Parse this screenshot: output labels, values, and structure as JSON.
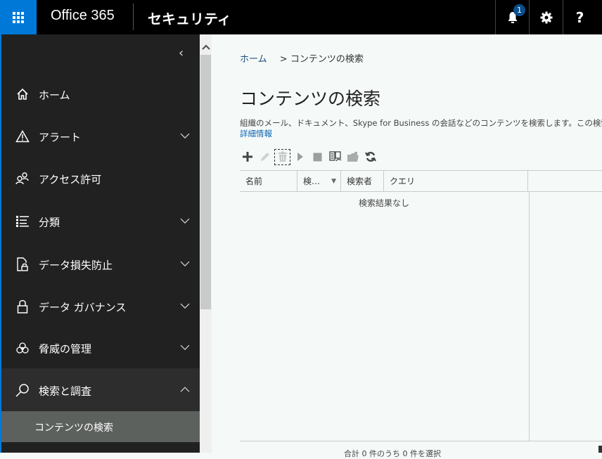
{
  "topbar": {
    "brand": "Office 365",
    "app_title": "セキュリティ",
    "notification_count": "1",
    "settings_icon": "gear-icon",
    "help_label": "?"
  },
  "sidebar": {
    "collapse_glyph": "‹",
    "items": [
      {
        "label": "ホーム",
        "icon": "home-icon",
        "expandable": false
      },
      {
        "label": "アラート",
        "icon": "alert-icon",
        "expandable": true
      },
      {
        "label": "アクセス許可",
        "icon": "people-icon",
        "expandable": false
      },
      {
        "label": "分類",
        "icon": "list-icon",
        "expandable": true
      },
      {
        "label": "データ損失防止",
        "icon": "document-lock-icon",
        "expandable": true
      },
      {
        "label": "データ ガバナンス",
        "icon": "lock-icon",
        "expandable": true
      },
      {
        "label": "脅威の管理",
        "icon": "biohazard-icon",
        "expandable": true
      },
      {
        "label": "検索と調査",
        "icon": "search-icon",
        "expandable": true,
        "expanded": true
      }
    ],
    "sub_items": [
      {
        "label": "コンテンツの検索",
        "selected": true
      }
    ]
  },
  "main": {
    "breadcrumb": {
      "home": "ホーム",
      "separator": ">",
      "current": "コンテンツの検索"
    },
    "title": "コンテンツの検索",
    "description": "組織のメール、ドキュメント、Skype for Business の会話などのコンテンツを検索します。この検索の結果のプ",
    "more_link": "詳細情報",
    "toolbar": [
      {
        "name": "add",
        "icon": "plus-icon",
        "enabled": true
      },
      {
        "name": "edit",
        "icon": "pencil-icon",
        "enabled": false
      },
      {
        "name": "delete",
        "icon": "trash-icon",
        "enabled": false
      },
      {
        "name": "start",
        "icon": "play-icon",
        "enabled": false
      },
      {
        "name": "stop",
        "icon": "stop-icon",
        "enabled": false
      },
      {
        "name": "preview",
        "icon": "preview-icon",
        "enabled": true
      },
      {
        "name": "export",
        "icon": "folder-export-icon",
        "enabled": false
      },
      {
        "name": "refresh",
        "icon": "refresh-icon",
        "enabled": true
      }
    ],
    "table": {
      "columns": [
        "名前",
        "検…",
        "検索者",
        "クエリ"
      ],
      "empty_text": "検索結果なし"
    },
    "footer": "合計 0 件のうち 0 件を選択"
  }
}
